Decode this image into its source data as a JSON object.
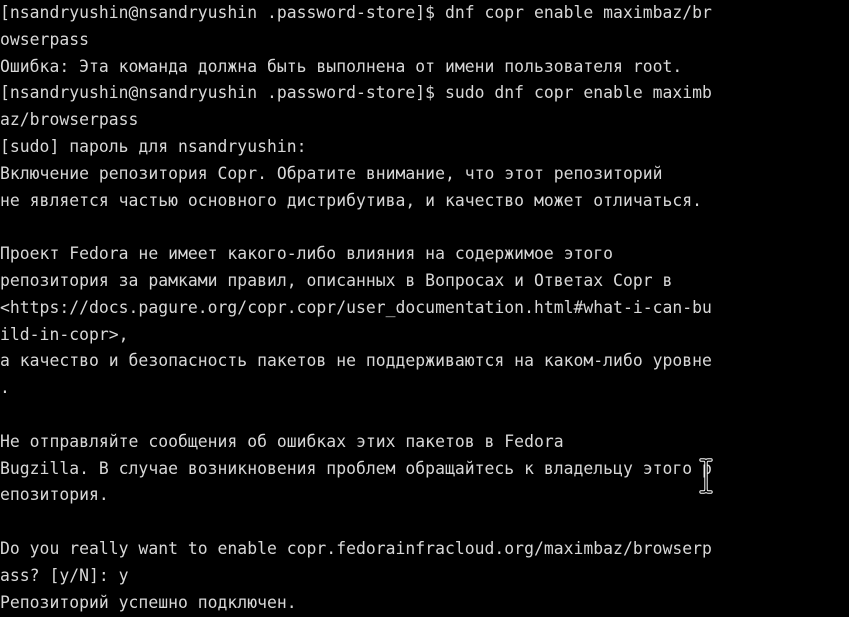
{
  "terminal": {
    "lines": [
      "[nsandryushin@nsandryushin .password-store]$ dnf copr enable maximbaz/br",
      "owserpass",
      "Ошибка: Эта команда должна быть выполнена от имени пользователя root.",
      "[nsandryushin@nsandryushin .password-store]$ sudo dnf copr enable maximb",
      "az/browserpass",
      "[sudo] пароль для nsandryushin:",
      "Включение репозитория Copr. Обратите внимание, что этот репозиторий",
      "не является частью основного дистрибутива, и качество может отличаться.",
      "",
      "Проект Fedora не имеет какого-либо влияния на содержимое этого",
      "репозитория за рамками правил, описанных в Вопросах и Ответах Copr в",
      "<https://docs.pagure.org/copr.copr/user_documentation.html#what-i-can-bu",
      "ild-in-copr>,",
      "а качество и безопасность пакетов не поддерживаются на каком-либо уровне",
      ".",
      "",
      "Не отправляйте сообщения об ошибках этих пакетов в Fedora",
      "Bugzilla. В случае возникновения проблем обращайтесь к владельцу этого р",
      "епозитория.",
      "",
      "Do you really want to enable copr.fedorainfracloud.org/maximbaz/browserp",
      "ass? [y/N]: y",
      "Репозиторий успешно подключен."
    ],
    "colors": {
      "background": "#000000",
      "foreground": "#d8d8d8"
    },
    "pointer_icon": "ibeam-cursor-icon"
  }
}
